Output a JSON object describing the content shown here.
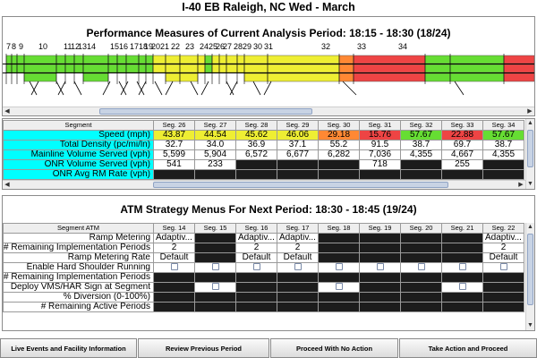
{
  "header": {
    "title": "I-40 EB   Raleigh, NC   Wed - March"
  },
  "colors": {
    "green": "#66dd33",
    "yellow": "#eeee33",
    "red": "#ee4444",
    "orange": "#ff8833",
    "cyan": "#00ffff",
    "dark": "#1c1c1c"
  },
  "performance": {
    "title": "Performance Measures of Current Analysis Period: 18:15 - 18:30   (18/24)",
    "segment_numbers": [
      "7",
      "8",
      "9",
      "10",
      "11",
      "12",
      "13",
      "14",
      "15",
      "16",
      "17",
      "18",
      "19",
      "20",
      "21",
      "22",
      "23",
      "24",
      "25",
      "26",
      "27",
      "28",
      "29",
      "30",
      "31",
      "32",
      "33",
      "34"
    ],
    "table": {
      "header_label": "Segment",
      "columns": [
        "Seg. 26",
        "Seg. 27",
        "Seg. 28",
        "Seg. 29",
        "Seg. 30",
        "Seg. 31",
        "Seg. 32",
        "Seg. 33",
        "Seg. 34"
      ],
      "rows": [
        {
          "label": "Speed (mph)",
          "values": [
            "43.87",
            "44.54",
            "45.62",
            "46.06",
            "29.18",
            "15.76",
            "57.67",
            "22.88",
            "57.67"
          ],
          "colors": [
            "#eeee33",
            "#eeee33",
            "#eeee33",
            "#eeee33",
            "#ff8833",
            "#ee4444",
            "#66dd33",
            "#ee4444",
            "#66dd33"
          ]
        },
        {
          "label": "Total Density (pc/mi/ln)",
          "values": [
            "32.7",
            "34.0",
            "36.9",
            "37.1",
            "55.2",
            "91.5",
            "38.7",
            "69.7",
            "38.7"
          ]
        },
        {
          "label": "Mainline Volume Served (vph)",
          "values": [
            "5,599",
            "5,904",
            "6,572",
            "6,677",
            "6,282",
            "7,036",
            "4,355",
            "4,667",
            "4,355"
          ]
        },
        {
          "label": "ONR Volume Served (vph)",
          "values": [
            "541",
            "233",
            "",
            "",
            "",
            "718",
            "",
            "255",
            ""
          ]
        },
        {
          "label": "ONR Avg RM Rate (vph)",
          "values": [
            "",
            "",
            "",
            "",
            "",
            "",
            "",
            "",
            ""
          ]
        }
      ]
    }
  },
  "atm": {
    "title": "ATM Strategy Menus For Next Period:  18:30 - 18:45  (19/24)",
    "table": {
      "header_label": "Segment ATM",
      "columns": [
        "Seg. 14",
        "Seg. 15",
        "Seg. 16",
        "Seg. 17",
        "Seg. 18",
        "Seg. 19",
        "Seg. 20",
        "Seg. 21",
        "Seg. 22"
      ],
      "rows": [
        {
          "label": "Ramp Metering",
          "values": [
            "Adaptiv...",
            "",
            "Adaptiv...",
            "Adaptiv...",
            "",
            "",
            "",
            "",
            "Adaptiv..."
          ]
        },
        {
          "label": "# Remaining Implementation Periods",
          "values": [
            "2",
            "",
            "2",
            "2",
            "",
            "",
            "",
            "",
            "2"
          ]
        },
        {
          "label": "Ramp Metering Rate",
          "values": [
            "Default",
            "",
            "Default",
            "Default",
            "",
            "",
            "",
            "",
            "Default"
          ]
        },
        {
          "label": "Enable Hard Shoulder Running",
          "values": [
            "[ ]",
            "[ ]",
            "[ ]",
            "[ ]",
            "[ ]",
            "[ ]",
            "[ ]",
            "[ ]",
            "[ ]"
          ]
        },
        {
          "label": "# Remaining Implementation Periods",
          "values": [
            "",
            "",
            "",
            "",
            "",
            "",
            "",
            "",
            ""
          ]
        },
        {
          "label": "Deploy VMS/HAR Sign at Segment",
          "values": [
            "",
            "[ ]",
            "",
            "",
            "[ ]",
            "",
            "",
            "[ ]",
            ""
          ]
        },
        {
          "label": "% Diversion (0-100%)",
          "values": [
            "",
            "",
            "",
            "",
            "",
            "",
            "",
            "",
            ""
          ]
        },
        {
          "label": "# Remaining Active Periods",
          "values": [
            "",
            "",
            "",
            "",
            "",
            "",
            "",
            "",
            ""
          ]
        }
      ]
    }
  },
  "buttons": {
    "live_events": "Live Events and Facility Information",
    "review_previous": "Review Previous Period",
    "proceed_no_action": "Proceed With No Action",
    "take_action": "Take Action and Proceed"
  }
}
